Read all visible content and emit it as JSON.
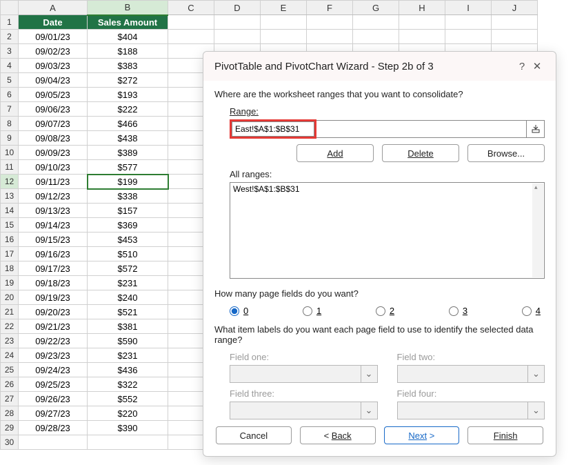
{
  "sheet": {
    "columns": [
      "A",
      "B",
      "C",
      "D",
      "E",
      "F",
      "G",
      "H",
      "I",
      "J"
    ],
    "header": {
      "A": "Date",
      "B": "Sales Amount"
    },
    "rows": [
      {
        "n": 1,
        "A": "Date",
        "B": "Sales Amount",
        "hd": true
      },
      {
        "n": 2,
        "A": "09/01/23",
        "B": "$404"
      },
      {
        "n": 3,
        "A": "09/02/23",
        "B": "$188"
      },
      {
        "n": 4,
        "A": "09/03/23",
        "B": "$383"
      },
      {
        "n": 5,
        "A": "09/04/23",
        "B": "$272"
      },
      {
        "n": 6,
        "A": "09/05/23",
        "B": "$193"
      },
      {
        "n": 7,
        "A": "09/06/23",
        "B": "$222"
      },
      {
        "n": 8,
        "A": "09/07/23",
        "B": "$466"
      },
      {
        "n": 9,
        "A": "09/08/23",
        "B": "$438"
      },
      {
        "n": 10,
        "A": "09/09/23",
        "B": "$389"
      },
      {
        "n": 11,
        "A": "09/10/23",
        "B": "$577"
      },
      {
        "n": 12,
        "A": "09/11/23",
        "B": "$199",
        "sel": true
      },
      {
        "n": 13,
        "A": "09/12/23",
        "B": "$338"
      },
      {
        "n": 14,
        "A": "09/13/23",
        "B": "$157"
      },
      {
        "n": 15,
        "A": "09/14/23",
        "B": "$369"
      },
      {
        "n": 16,
        "A": "09/15/23",
        "B": "$453"
      },
      {
        "n": 17,
        "A": "09/16/23",
        "B": "$510"
      },
      {
        "n": 18,
        "A": "09/17/23",
        "B": "$572"
      },
      {
        "n": 19,
        "A": "09/18/23",
        "B": "$231"
      },
      {
        "n": 20,
        "A": "09/19/23",
        "B": "$240"
      },
      {
        "n": 21,
        "A": "09/20/23",
        "B": "$521"
      },
      {
        "n": 22,
        "A": "09/21/23",
        "B": "$381"
      },
      {
        "n": 23,
        "A": "09/22/23",
        "B": "$590"
      },
      {
        "n": 24,
        "A": "09/23/23",
        "B": "$231"
      },
      {
        "n": 25,
        "A": "09/24/23",
        "B": "$436"
      },
      {
        "n": 26,
        "A": "09/25/23",
        "B": "$322"
      },
      {
        "n": 27,
        "A": "09/26/23",
        "B": "$552"
      },
      {
        "n": 28,
        "A": "09/27/23",
        "B": "$220"
      },
      {
        "n": 29,
        "A": "09/28/23",
        "B": "$390"
      },
      {
        "n": 30,
        "A": "",
        "B": ""
      }
    ],
    "selected_cell": "B12"
  },
  "dialog": {
    "title": "PivotTable and PivotChart Wizard - Step 2b of 3",
    "help": "?",
    "close": "✕",
    "question1": "Where are the worksheet ranges that you want to consolidate?",
    "range_label": "Range:",
    "range_value": "East!$A$1:$B$31",
    "buttons": {
      "add": "Add",
      "delete_pre": "",
      "delete": "Delete",
      "browse": "Browse..."
    },
    "all_ranges_label": "All ranges:",
    "all_ranges_items": [
      "West!$A$1:$B$31"
    ],
    "question2": "How many page fields do you want?",
    "page_options": [
      "0",
      "1",
      "2",
      "3",
      "4"
    ],
    "page_selected": "0",
    "question3": "What item labels do you want each page field to use to identify the selected data range?",
    "fields": {
      "f1": "Field one:",
      "f2": "Field two:",
      "f3": "Field three:",
      "f4": "Field four:"
    },
    "nav": {
      "cancel": "Cancel",
      "back_pre": "< ",
      "back": "Back",
      "next": "Next",
      "next_post": " >",
      "finish_pre": "",
      "finish": "Finish"
    }
  }
}
